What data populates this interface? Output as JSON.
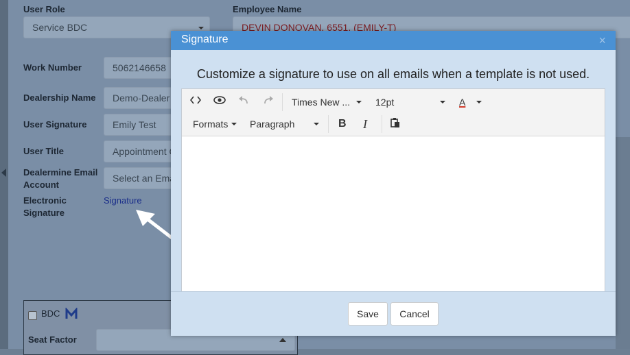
{
  "form": {
    "user_role_label": "User Role",
    "user_role_value": "Service BDC",
    "employee_name_label": "Employee Name",
    "employee_name_value": "DEVIN DONOVAN, 6551, (EMILY-T)",
    "work_number_label": "Work Number",
    "work_number_value": "5062146658",
    "dealership_name_label": "Dealership Name",
    "dealership_name_value": "Demo-Dealer",
    "user_signature_label": "User Signature",
    "user_signature_value": "Emily Test",
    "user_title_label": "User Title",
    "user_title_value": "Appointment C",
    "email_account_label_1": "Dealermine Email",
    "email_account_label_2": "Account",
    "email_account_value": "Select an Ema",
    "electronic_sig_label_1": "Electronic",
    "electronic_sig_label_2": "Signature",
    "signature_link": "Signature",
    "bdc_label": "BDC",
    "seat_factor_label": "Seat Factor"
  },
  "modal": {
    "title": "Signature",
    "close": "×",
    "message": "Customize a signature to use on all emails when a template is not used.",
    "toolbar": {
      "font_family": "Times New ...",
      "font_size": "12pt",
      "text_color_letter": "A",
      "formats": "Formats",
      "block": "Paragraph",
      "bold": "B",
      "italic": "I"
    },
    "save_label": "Save",
    "cancel_label": "Cancel"
  },
  "icons": [
    "code-icon",
    "preview-eye-icon",
    "undo-icon",
    "redo-icon",
    "paste-icon",
    "m-logo-icon",
    "left-arrow-icon",
    "pointer-arrow-icon"
  ],
  "colors": {
    "modal_header": "#4a91d4",
    "modal_body": "#cfe0f1",
    "overlay_bg": "#7a8ea6",
    "link": "#1a2e8a",
    "employee_name_text": "#7a1c22",
    "text_color_underline": "#d03a2a"
  }
}
